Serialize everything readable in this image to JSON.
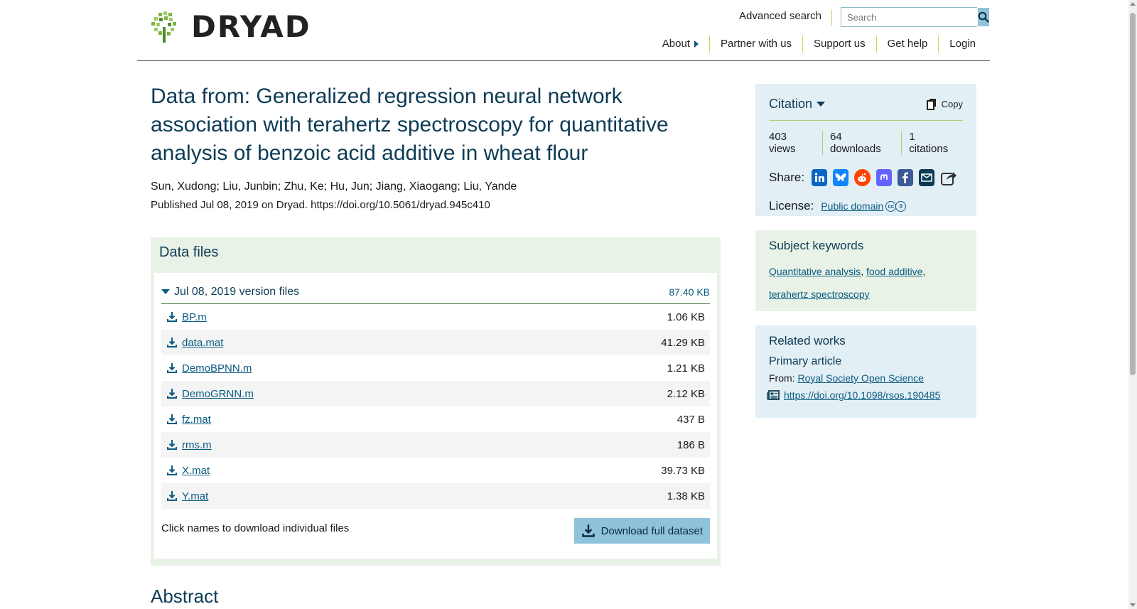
{
  "header": {
    "logo_text": "DRYAD",
    "advanced_search": "Advanced search",
    "search_placeholder": "Search",
    "nav": [
      "About",
      "Partner with us",
      "Support us",
      "Get help",
      "Login"
    ]
  },
  "dataset": {
    "title": "Data from: Generalized regression neural network association with terahertz spectroscopy for quantitative analysis of benzoic acid additive in wheat flour",
    "authors": "Sun, Xudong; Liu, Junbin; Zhu, Ke; Hu, Jun; Jiang, Xiaogang; Liu, Yande",
    "published": "Published Jul 08, 2019 on Dryad. https://doi.org/10.5061/dryad.945c410"
  },
  "data_files": {
    "title": "Data files",
    "version_label": "Jul 08, 2019 version files",
    "version_size": "87.40 KB",
    "files": [
      {
        "name": "BP.m",
        "size": "1.06 KB"
      },
      {
        "name": "data.mat",
        "size": "41.29 KB"
      },
      {
        "name": "DemoBPNN.m",
        "size": "1.21 KB"
      },
      {
        "name": "DemoGRNN.m",
        "size": "2.12 KB"
      },
      {
        "name": "fz.mat",
        "size": "437 B"
      },
      {
        "name": "rms.m",
        "size": "186 B"
      },
      {
        "name": "X.mat",
        "size": "39.73 KB"
      },
      {
        "name": "Y.mat",
        "size": "1.38 KB"
      }
    ],
    "hint": "Click names to download individual files",
    "download_label": "Download full dataset"
  },
  "abstract_heading": "Abstract",
  "citation": {
    "title": "Citation",
    "copy_label": "Copy",
    "views": "403 views",
    "downloads": "64 downloads",
    "citations": "1 citations",
    "share_label": "Share:",
    "license_label": "License:",
    "license_link": "Public domain"
  },
  "keywords": {
    "title": "Subject keywords",
    "items": [
      "Quantitative analysis",
      "food additive",
      "terahertz spectroscopy"
    ],
    "sep": ","
  },
  "related": {
    "title": "Related works",
    "subtitle": "Primary article",
    "from_label": "From:",
    "from_link": "Royal Society Open Science",
    "doi": "https://doi.org/10.1098/rsos.190485"
  },
  "colors": {
    "primary": "#0d3b55",
    "link": "#0b5b83",
    "green_panel": "#e8f2e6",
    "blue_panel": "#e2eff5",
    "accent_yellow": "#d8cf63",
    "button_blue": "#8fc3dc"
  }
}
